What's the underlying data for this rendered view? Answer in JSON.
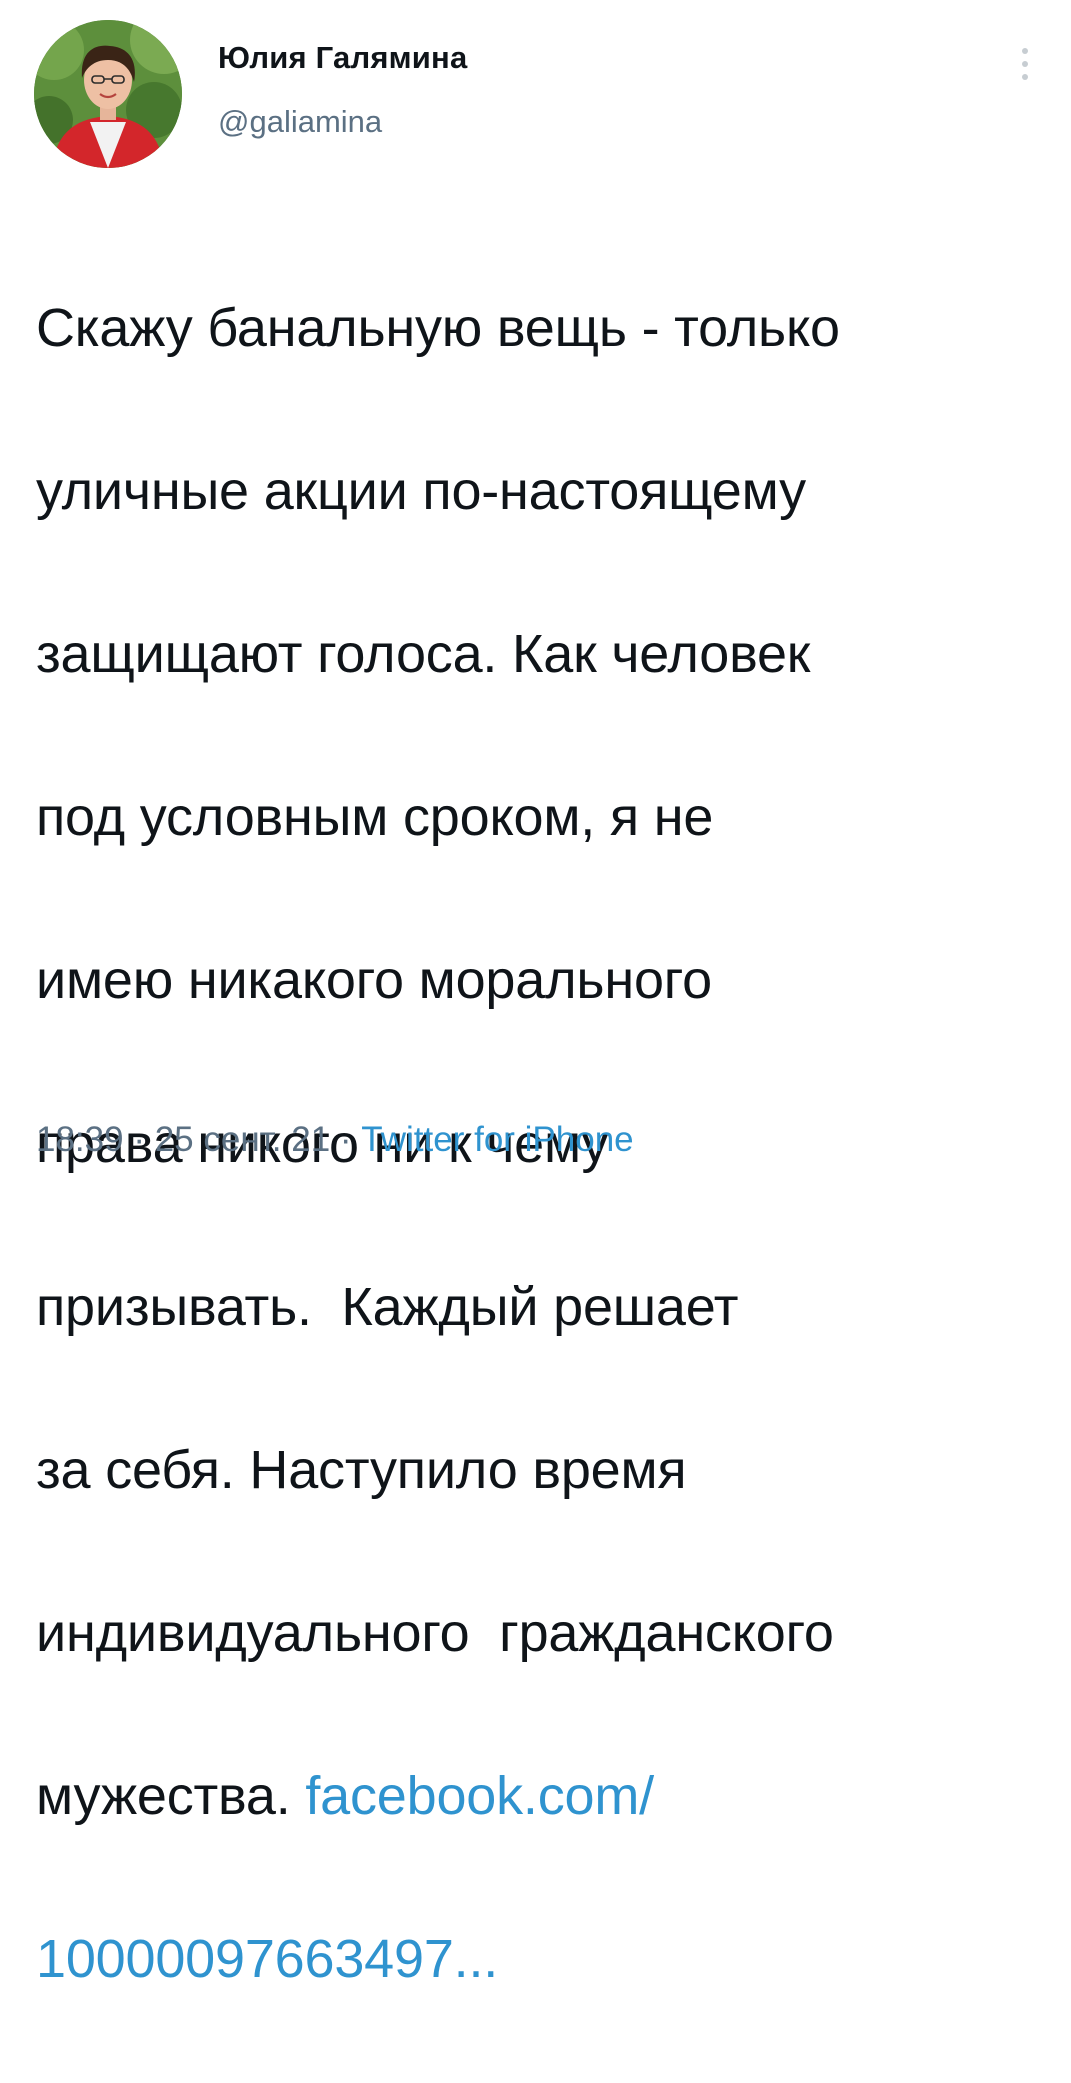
{
  "author": {
    "display_name": "Юлия Галямина",
    "handle": "@galiamina"
  },
  "tweet": {
    "lines": [
      "Скажу банальную вещь - только",
      "уличные акции по-настоящему",
      "защищают голоса. Как человек",
      "под условным сроком, я не",
      "имею никакого морального",
      "права никого ни к чему",
      "призывать.  Каждый решает",
      "за себя. Наступило время",
      "индивидуального  гражданского"
    ],
    "last_text": "мужества. ",
    "link_part1": "facebook.com/",
    "link_part2": "10000097663497..."
  },
  "meta": {
    "time": "18:39",
    "separator": " · ",
    "date": "25 сент. 21",
    "source": "Twitter for iPhone"
  },
  "icons": {
    "more": "more-vertical-icon"
  },
  "colors": {
    "link": "#2f93cf",
    "secondary_text": "#5b7083",
    "primary_text": "#0f1419"
  }
}
